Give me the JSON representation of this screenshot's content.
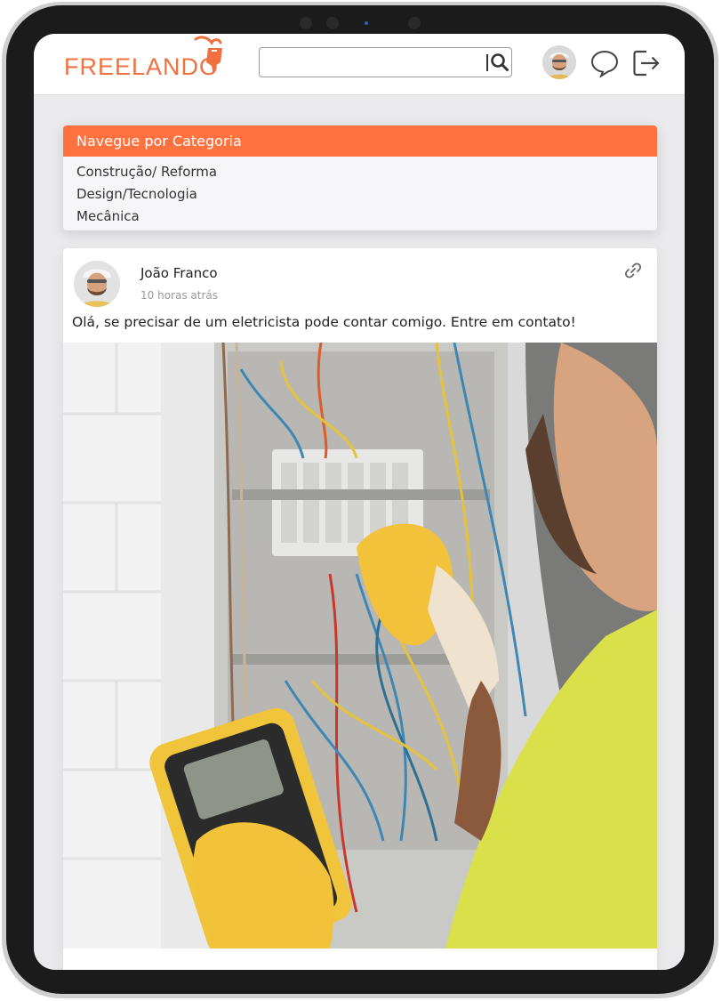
{
  "app": {
    "brand": "FREELANDO"
  },
  "search": {
    "value": "",
    "placeholder": ""
  },
  "header": {
    "icons": [
      "search-icon",
      "user-avatar",
      "chat-bubble-icon",
      "logout-icon"
    ]
  },
  "categories": {
    "title": "Navegue por Categoria",
    "items": [
      {
        "label": "Construção/ Reforma"
      },
      {
        "label": "Design/Tecnologia"
      },
      {
        "label": "Mecânica"
      }
    ]
  },
  "post": {
    "author": "João Franco",
    "time": "10 horas atrás",
    "text": "Olá, se precisar de um eletricista pode contar comigo. Entre em contato!",
    "icons": [
      "link-icon"
    ]
  },
  "colors": {
    "accent": "#ff7240",
    "logo": "#f07040",
    "screen_bg": "#eaeaed",
    "card_bg": "#f6f6f8"
  }
}
